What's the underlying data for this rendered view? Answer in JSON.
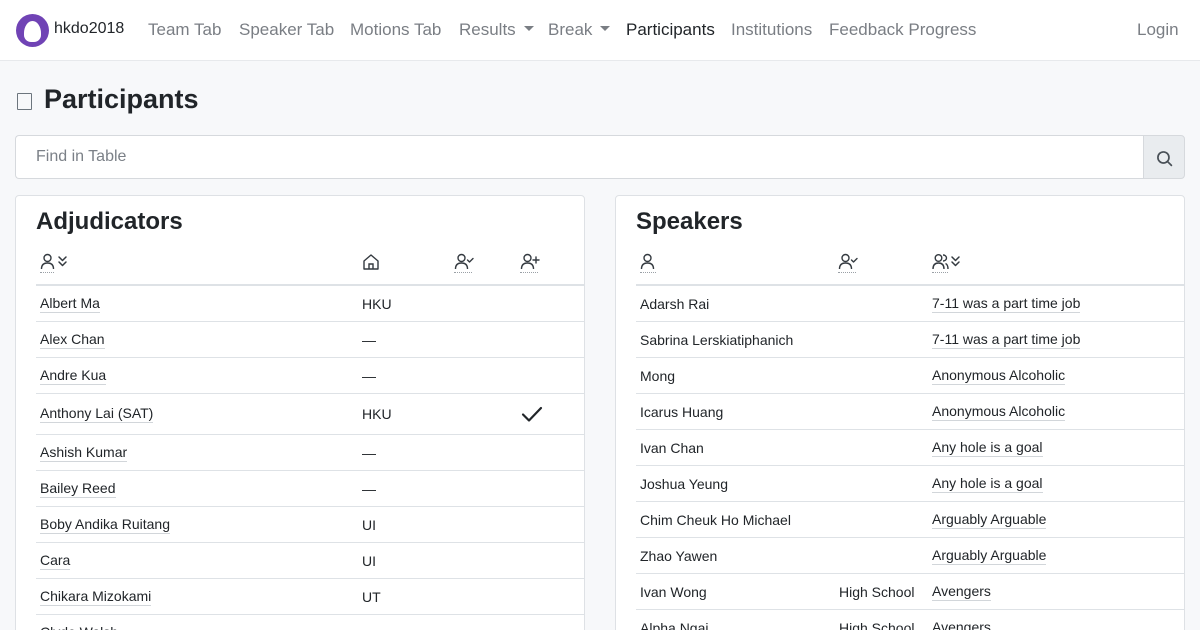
{
  "navbar": {
    "brand": "hkdo2018",
    "items": [
      {
        "label": "Team Tab"
      },
      {
        "label": "Speaker Tab"
      },
      {
        "label": "Motions Tab"
      },
      {
        "label": "Results"
      },
      {
        "label": "Break"
      },
      {
        "label": "Participants"
      },
      {
        "label": "Institutions"
      },
      {
        "label": "Feedback Progress"
      }
    ],
    "login": "Login",
    "accent": "#7043b5"
  },
  "page": {
    "title": "Participants",
    "title_icon": "clipboard-icon"
  },
  "search": {
    "placeholder": "Find in Table",
    "icon": "search-icon"
  },
  "adjudicators": {
    "title": "Adjudicators",
    "headers": [
      "user-sort-icon",
      "institution-icon",
      "user-check-icon",
      "user-plus-icon"
    ],
    "rows": [
      {
        "name": "Albert Ma",
        "institution": "HKU",
        "checked": false
      },
      {
        "name": "Alex Chan",
        "institution": "—",
        "checked": false
      },
      {
        "name": "Andre Kua",
        "institution": "—",
        "checked": false
      },
      {
        "name": "Anthony Lai (SAT)",
        "institution": "HKU",
        "checked": true
      },
      {
        "name": "Ashish Kumar",
        "institution": "—",
        "checked": false
      },
      {
        "name": "Bailey Reed",
        "institution": "—",
        "checked": false
      },
      {
        "name": "Boby Andika Ruitang",
        "institution": "UI",
        "checked": false
      },
      {
        "name": "Cara",
        "institution": "UI",
        "checked": false
      },
      {
        "name": "Chikara Mizokami",
        "institution": "UT",
        "checked": false
      },
      {
        "name": "Clyde Walsh",
        "institution": "",
        "checked": false
      }
    ]
  },
  "speakers": {
    "title": "Speakers",
    "headers": [
      "user-icon",
      "user-check-icon",
      "team-sort-icon"
    ],
    "rows": [
      {
        "name": "Adarsh Rai",
        "category": "",
        "team": "7-11 was a part time job"
      },
      {
        "name": "Sabrina Lerskiatiphanich",
        "category": "",
        "team": "7-11 was a part time job"
      },
      {
        "name": "Mong",
        "category": "",
        "team": "Anonymous Alcoholic"
      },
      {
        "name": "Icarus Huang",
        "category": "",
        "team": "Anonymous Alcoholic"
      },
      {
        "name": "Ivan Chan",
        "category": "",
        "team": "Any hole is a goal"
      },
      {
        "name": "Joshua Yeung",
        "category": "",
        "team": "Any hole is a goal"
      },
      {
        "name": "Chim Cheuk Ho Michael",
        "category": "",
        "team": "Arguably Arguable"
      },
      {
        "name": "Zhao Yawen",
        "category": "",
        "team": "Arguably Arguable"
      },
      {
        "name": "Ivan Wong",
        "category": "High School",
        "team": "Avengers"
      },
      {
        "name": "Alpha Ngai",
        "category": "High School",
        "team": "Avengers"
      }
    ]
  }
}
